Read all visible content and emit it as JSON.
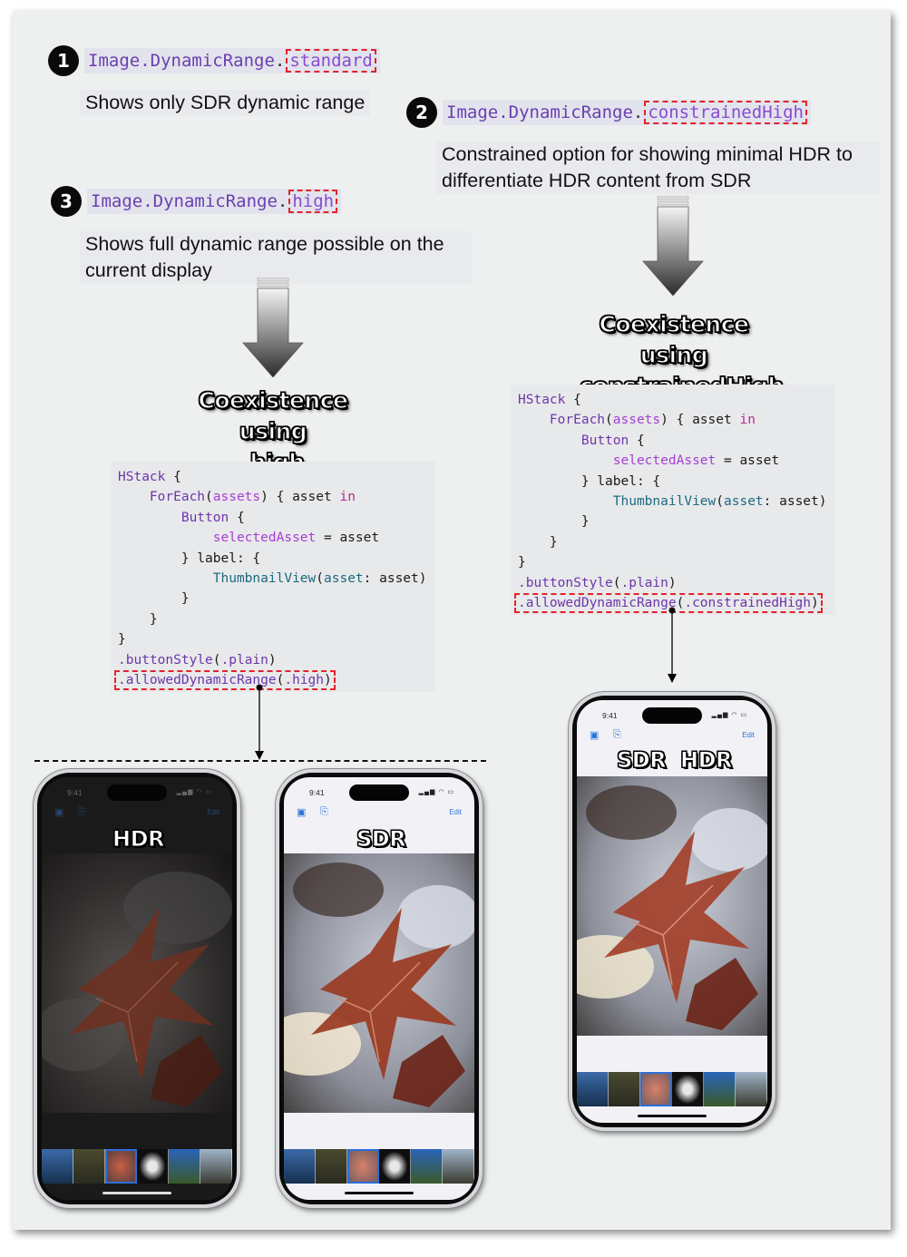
{
  "options": [
    {
      "number": "1",
      "code_prefix": "Image.DynamicRange",
      "dot": ".",
      "value": "standard",
      "description": "Shows only SDR dynamic range"
    },
    {
      "number": "2",
      "code_prefix": "Image.DynamicRange",
      "dot": ".",
      "value": "constrainedHigh",
      "description_line1": "Constrained option for showing minimal HDR to",
      "description_line2": "differentiate HDR content from SDR"
    },
    {
      "number": "3",
      "code_prefix": "Image.DynamicRange",
      "dot": ".",
      "value": "high",
      "description_line1": "Shows full dynamic range possible on the",
      "description_line2": "current display"
    }
  ],
  "coexistence_high": {
    "line1": "Coexistence using",
    "line2": ".high"
  },
  "coexistence_constrained": {
    "line1": "Coexistence using",
    "line2": ".constrainedHigh"
  },
  "code_left": {
    "hstack": "HStack",
    "brace_open": " {",
    "foreach": "ForEach",
    "assets": "assets",
    "closure_open": ") { asset ",
    "in_kw": "in",
    "button": "Button",
    "selected": "selectedAsset",
    "assign": " = asset",
    "label_line": "} label: {",
    "thumbnail": "ThumbnailView",
    "asset_label": "asset",
    "asset_arg": ": asset)",
    "close": "}",
    "button_style": ".buttonStyle",
    "plain": ".plain",
    "allowed": ".allowedDynamicRange",
    "allowed_value": ".high"
  },
  "code_right": {
    "hstack": "HStack",
    "brace_open": " {",
    "foreach": "ForEach",
    "assets": "assets",
    "closure_open": ") { asset ",
    "in_kw": "in",
    "button": "Button",
    "selected": "selectedAsset",
    "assign": " = asset",
    "label_line": "} label: {",
    "thumbnail": "ThumbnailView",
    "asset_label": "asset",
    "asset_arg": ": asset)",
    "close": "}",
    "button_style": ".buttonStyle",
    "plain": ".plain",
    "allowed": ".allowedDynamicRange",
    "allowed_value": ".constrainedHigh"
  },
  "phones": [
    {
      "time": "9:41",
      "edit": "Edit",
      "labels": [
        "HDR"
      ],
      "theme": "dark"
    },
    {
      "time": "9:41",
      "edit": "Edit",
      "labels": [
        "SDR"
      ],
      "theme": "light"
    },
    {
      "time": "9:41",
      "edit": "Edit",
      "labels": [
        "SDR",
        "HDR"
      ],
      "theme": "light"
    }
  ],
  "colors": {
    "highlight_dash": "#e0242a",
    "code_purple": "#6c36a9",
    "code_teal": "#1c6a80",
    "selected_thumb": "#2c6ed8"
  },
  "icons": [
    "photo-icon",
    "document-icon",
    "signal-icon",
    "wifi-icon",
    "battery-icon"
  ]
}
